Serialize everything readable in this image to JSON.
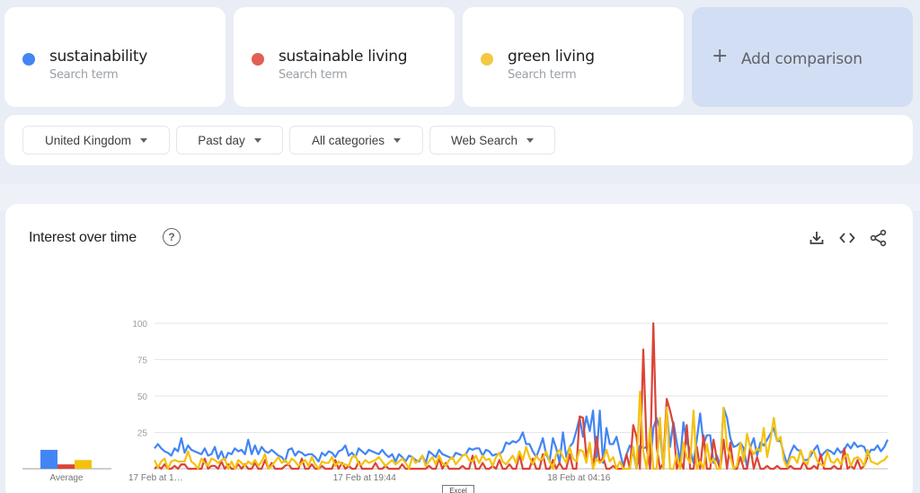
{
  "terms": [
    {
      "name": "sustainability",
      "subtitle": "Search term",
      "color": "#4285f4"
    },
    {
      "name": "sustainable living",
      "subtitle": "Search term",
      "color": "#db4437"
    },
    {
      "name": "green living",
      "subtitle": "Search term",
      "color": "#f4c20d"
    }
  ],
  "add_comparison": {
    "icon": "plus-icon",
    "label": "Add comparison"
  },
  "filters": [
    {
      "label": "United Kingdom"
    },
    {
      "label": "Past day"
    },
    {
      "label": "All categories"
    },
    {
      "label": "Web Search"
    }
  ],
  "panel": {
    "title": "Interest over time",
    "help_icon": "question-circle-icon",
    "actions": [
      "download-icon",
      "embed-code-icon",
      "share-icon"
    ]
  },
  "tooltip_stub": "Excel",
  "chart_data": [
    {
      "type": "bar",
      "title": "Average",
      "categories": [
        "sustainability",
        "sustainable living",
        "green living"
      ],
      "values": [
        13,
        3,
        6
      ],
      "colors": [
        "#4285f4",
        "#db4437",
        "#f4c20d"
      ],
      "xlabel": "Average",
      "ylim": [
        0,
        100
      ]
    },
    {
      "type": "line",
      "title": "Interest over time",
      "xlabel": "",
      "ylabel": "",
      "ylim": [
        0,
        100
      ],
      "yticks": [
        25,
        50,
        75,
        100
      ],
      "grid": true,
      "x_tick_labels": [
        {
          "label": "17 Feb at 1…",
          "index": 0
        },
        {
          "label": "17 Feb at 19:44",
          "index": 63
        },
        {
          "label": "18 Feb at 04:16",
          "index": 127
        }
      ],
      "series": [
        {
          "name": "sustainability",
          "color": "#4285f4",
          "values": [
            14,
            17,
            14,
            12,
            11,
            9,
            14,
            12,
            21,
            11,
            16,
            13,
            12,
            11,
            10,
            14,
            9,
            10,
            15,
            7,
            12,
            6,
            11,
            10,
            14,
            12,
            13,
            10,
            20,
            10,
            16,
            10,
            15,
            12,
            11,
            13,
            11,
            9,
            8,
            5,
            13,
            14,
            9,
            12,
            11,
            9,
            10,
            10,
            8,
            5,
            11,
            9,
            12,
            11,
            8,
            12,
            13,
            16,
            9,
            11,
            8,
            14,
            12,
            10,
            13,
            12,
            11,
            10,
            13,
            10,
            8,
            10,
            5,
            10,
            8,
            5,
            9,
            8,
            6,
            5,
            9,
            4,
            12,
            10,
            8,
            13,
            10,
            9,
            8,
            7,
            11,
            10,
            9,
            10,
            14,
            13,
            14,
            14,
            9,
            13,
            12,
            9,
            10,
            10,
            12,
            18,
            17,
            19,
            18,
            20,
            25,
            17,
            17,
            12,
            8,
            14,
            21,
            10,
            5,
            21,
            14,
            4,
            25,
            8,
            15,
            18,
            26,
            35,
            22,
            36,
            26,
            40,
            6,
            40,
            4,
            28,
            17,
            17,
            22,
            12,
            2,
            10,
            16,
            12,
            0,
            16,
            14,
            15,
            1,
            28,
            35,
            27,
            0,
            40,
            15,
            32,
            18,
            5,
            32,
            18,
            13,
            4,
            20,
            38,
            17,
            23,
            23,
            4,
            9,
            2,
            42,
            35,
            21,
            15,
            16,
            18,
            14,
            1,
            15,
            21,
            9,
            18,
            16,
            20,
            24,
            28,
            19,
            19,
            10,
            3,
            11,
            16,
            13,
            12,
            6,
            6,
            9,
            13,
            16,
            8,
            11,
            13,
            12,
            10,
            14,
            11,
            13,
            17,
            14,
            18,
            15,
            16,
            15,
            9,
            13,
            13,
            16,
            12,
            15,
            20
          ]
        },
        {
          "name": "sustainable living",
          "color": "#db4437",
          "values": [
            0,
            2,
            0,
            3,
            0,
            0,
            2,
            0,
            3,
            3,
            0,
            0,
            0,
            0,
            0,
            7,
            0,
            2,
            2,
            0,
            5,
            0,
            3,
            0,
            0,
            3,
            0,
            3,
            0,
            0,
            4,
            0,
            0,
            6,
            0,
            4,
            0,
            0,
            0,
            2,
            3,
            0,
            0,
            0,
            7,
            0,
            0,
            3,
            0,
            0,
            2,
            0,
            0,
            0,
            6,
            0,
            4,
            0,
            2,
            0,
            0,
            5,
            0,
            0,
            0,
            0,
            4,
            0,
            0,
            2,
            0,
            0,
            0,
            0,
            3,
            0,
            0,
            0,
            0,
            0,
            0,
            0,
            2,
            0,
            0,
            7,
            0,
            4,
            0,
            0,
            0,
            0,
            2,
            0,
            0,
            9,
            0,
            0,
            4,
            0,
            0,
            2,
            0,
            6,
            0,
            0,
            3,
            0,
            0,
            10,
            0,
            0,
            0,
            7,
            0,
            0,
            10,
            0,
            0,
            6,
            0,
            4,
            0,
            0,
            10,
            0,
            0,
            36,
            35,
            8,
            17,
            0,
            22,
            4,
            8,
            0,
            0,
            2,
            0,
            0,
            0,
            10,
            0,
            30,
            22,
            0,
            82,
            15,
            0,
            100,
            15,
            0,
            4,
            48,
            40,
            30,
            0,
            6,
            0,
            30,
            0,
            0,
            15,
            0,
            23,
            0,
            0,
            20,
            6,
            0,
            20,
            0,
            18,
            0,
            0,
            8,
            0,
            0,
            15,
            0,
            8,
            0,
            0,
            2,
            0,
            0,
            2,
            0,
            0,
            0,
            2,
            0,
            0,
            0,
            5,
            0,
            0,
            2,
            0,
            10,
            0,
            0,
            0,
            2,
            0,
            0,
            14,
            0,
            2,
            0,
            6,
            0,
            2,
            8
          ]
        },
        {
          "name": "green living",
          "color": "#f4c20d",
          "values": [
            6,
            1,
            5,
            7,
            0,
            5,
            6,
            5,
            5,
            5,
            12,
            5,
            3,
            0,
            7,
            4,
            2,
            7,
            6,
            4,
            6,
            7,
            0,
            5,
            0,
            6,
            4,
            2,
            5,
            3,
            6,
            2,
            5,
            10,
            0,
            2,
            5,
            8,
            4,
            6,
            3,
            7,
            5,
            2,
            4,
            6,
            2,
            8,
            3,
            0,
            5,
            4,
            4,
            8,
            2,
            5,
            3,
            3,
            2,
            8,
            9,
            3,
            3,
            6,
            4,
            5,
            6,
            8,
            5,
            2,
            4,
            6,
            3,
            5,
            7,
            4,
            0,
            8,
            4,
            6,
            9,
            2,
            5,
            8,
            3,
            9,
            4,
            2,
            6,
            8,
            3,
            6,
            9,
            10,
            6,
            5,
            9,
            4,
            9,
            6,
            7,
            2,
            8,
            11,
            5,
            3,
            6,
            9,
            4,
            12,
            6,
            15,
            8,
            3,
            9,
            6,
            7,
            12,
            5,
            0,
            10,
            13,
            8,
            4,
            15,
            7,
            5,
            13,
            12,
            4,
            18,
            0,
            7,
            4,
            6,
            13,
            5,
            8,
            0,
            5,
            0,
            0,
            0,
            15,
            0,
            53,
            12,
            0,
            28,
            0,
            0,
            35,
            0,
            42,
            0,
            0,
            10,
            0,
            18,
            8,
            4,
            40,
            0,
            5,
            0,
            17,
            4,
            7,
            0,
            0,
            42,
            15,
            8,
            0,
            2,
            18,
            5,
            24,
            14,
            10,
            14,
            12,
            28,
            8,
            20,
            35,
            19,
            22,
            6,
            1,
            8,
            8,
            4,
            13,
            5,
            3,
            12,
            12,
            5,
            3,
            2,
            12,
            5,
            4,
            7,
            3,
            8,
            10,
            2,
            7,
            8,
            6,
            2,
            13,
            5,
            4,
            3,
            5,
            6,
            9
          ]
        }
      ]
    }
  ]
}
